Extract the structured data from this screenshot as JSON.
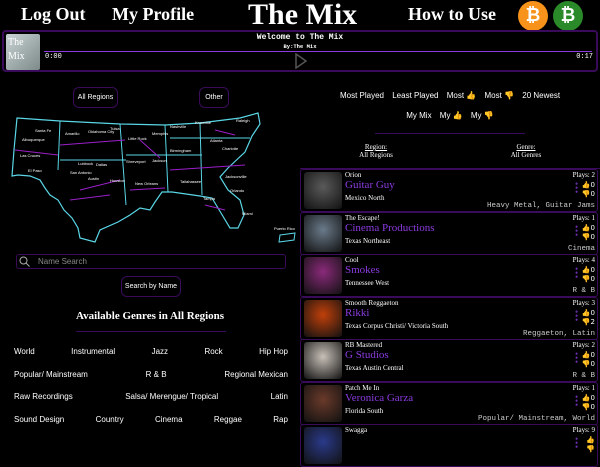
{
  "header": {
    "logout": "Log Out",
    "profile": "My Profile",
    "title": "The Mix",
    "how_to": "How to Use",
    "coins": [
      {
        "icon": "bitcoin-icon",
        "glyph": "₿",
        "color": "#f7931a"
      },
      {
        "icon": "bitcoin-cash-icon",
        "glyph": "₿",
        "color": "#2a8a2a"
      }
    ]
  },
  "player": {
    "title": "Welcome to The Mix",
    "by": "By:The Mix",
    "current": "0:00",
    "duration": "0:17",
    "thumb_text": "The Mix",
    "progress": 0
  },
  "map": {
    "all_regions": "All Regions",
    "other": "Other",
    "labels": [
      "Santa Fe",
      "Albuquerque",
      "Las Cruces",
      "El Paso",
      "Amarillo",
      "Lubbock",
      "Oklahoma City",
      "Tulsa",
      "Little Rock",
      "Memphis",
      "Nashville",
      "Knoxville",
      "Charlotte",
      "Raleigh",
      "Atlanta",
      "Jackson",
      "Birmingham",
      "Shreveport",
      "Dallas",
      "Austin",
      "San Antonio",
      "Houston",
      "New Orleans",
      "Tallahassee",
      "Jacksonville",
      "Orlando",
      "Tampa",
      "Miami",
      "Puerto Rico"
    ]
  },
  "search": {
    "placeholder": "Name Search",
    "button": "Search by Name"
  },
  "genres": {
    "title": "Available Genres in All Regions",
    "rows": [
      [
        "World",
        "Instrumental",
        "Jazz",
        "Rock",
        "Hip Hop"
      ],
      [
        "Popular/ Mainstream",
        "R & B",
        "Regional Mexican"
      ],
      [
        "Raw Recordings",
        "Salsa/ Merengue/ Tropical",
        "Latin"
      ],
      [
        "Sound Design",
        "Country",
        "Cinema",
        "Reggae",
        "Rap"
      ]
    ]
  },
  "sorts": {
    "row1": [
      "Most Played",
      "Least Played",
      "Most 👍",
      "Most 👎",
      "20 Newest"
    ],
    "row2": [
      "My Mix",
      "My 👍",
      "My 👎"
    ]
  },
  "filters": {
    "region_label": "Region:",
    "region": "All Regions",
    "genre_label": "Genre:",
    "genre": "All Genres"
  },
  "tracks": [
    {
      "track": "Orion",
      "artist": "Guitar Guy",
      "region": "Mexico North",
      "plays": "Plays: 2",
      "up": "0",
      "down": "0",
      "genres": "Heavy Metal, Guitar Jams",
      "img": "#5a5a5a"
    },
    {
      "track": "The Escape!",
      "artist": "Cinema Productions",
      "region": "Texas Northeast",
      "plays": "Plays: 1",
      "up": "0",
      "down": "0",
      "genres": "Cinema",
      "img": "#6a7a8a"
    },
    {
      "track": "Cool",
      "artist": "Smokes",
      "region": "Tennessee West",
      "plays": "Plays: 4",
      "up": "0",
      "down": "0",
      "genres": "R & B",
      "img": "#8a2a7a"
    },
    {
      "track": "Smooth Reggaeton",
      "artist": "Rikki",
      "region": "Texas Corpus Christi/ Victoria South",
      "plays": "Plays: 3",
      "up": "0",
      "down": "2",
      "genres": "Reggaeton, Latin",
      "img": "#c0400a"
    },
    {
      "track": "RB Mastered",
      "artist": "G Studios",
      "region": "Texas Austin Central",
      "plays": "Plays: 2",
      "up": "0",
      "down": "0",
      "genres": "R & B",
      "img": "#c8c0b8"
    },
    {
      "track": "Patch Me In",
      "artist": "Veronica Garza",
      "region": "Florida South",
      "plays": "Plays: 1",
      "up": "0",
      "down": "0",
      "genres": "Popular/ Mainstream, World",
      "img": "#6a3a2a"
    },
    {
      "track": "Swagga",
      "artist": "",
      "region": "",
      "plays": "Plays: 9",
      "up": "",
      "down": "",
      "genres": "",
      "img": "#2a3a8a"
    }
  ]
}
